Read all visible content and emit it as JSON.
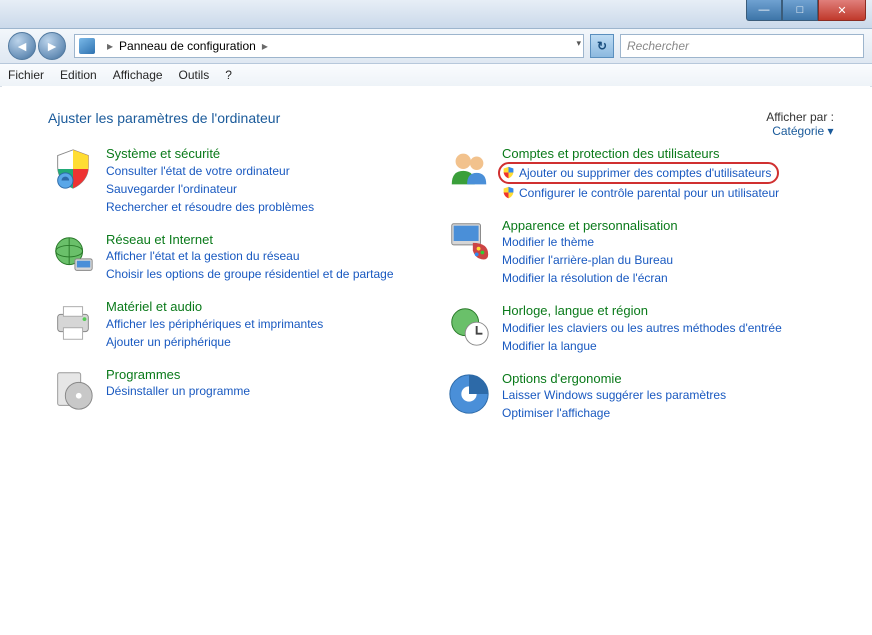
{
  "titlebar": {
    "min": "—",
    "max": "□",
    "close": "✕"
  },
  "nav": {
    "back": "◄",
    "forward": "►",
    "refresh": "↻"
  },
  "address": {
    "location": "Panneau de configuration",
    "sep": "▸",
    "dropdown": "▾"
  },
  "search": {
    "placeholder": "Rechercher"
  },
  "menu": {
    "file": "Fichier",
    "edit": "Edition",
    "view": "Affichage",
    "tools": "Outils",
    "help": "?"
  },
  "page": {
    "heading": "Ajuster les paramètres de l'ordinateur",
    "viewby_label": "Afficher par :",
    "viewby_value": "Catégorie ▾"
  },
  "left": [
    {
      "title": "Système et sécurité",
      "links": [
        "Consulter l'état de votre ordinateur",
        "Sauvegarder l'ordinateur",
        "Rechercher et résoudre des problèmes"
      ]
    },
    {
      "title": "Réseau et Internet",
      "links": [
        "Afficher l'état et la gestion du réseau",
        "Choisir les options de groupe résidentiel et de partage"
      ]
    },
    {
      "title": "Matériel et audio",
      "links": [
        "Afficher les périphériques et imprimantes",
        "Ajouter un périphérique"
      ]
    },
    {
      "title": "Programmes",
      "links": [
        "Désinstaller un programme"
      ]
    }
  ],
  "right": [
    {
      "title": "Comptes et protection des utilisateurs",
      "links": [
        "Ajouter ou supprimer des comptes d'utilisateurs",
        "Configurer le contrôle parental pour un utilisateur"
      ],
      "shield": [
        true,
        true
      ],
      "highlight": 0
    },
    {
      "title": "Apparence et personnalisation",
      "links": [
        "Modifier le thème",
        "Modifier l'arrière-plan du Bureau",
        "Modifier la résolution de l'écran"
      ]
    },
    {
      "title": "Horloge, langue et région",
      "links": [
        "Modifier les claviers ou les autres méthodes d'entrée",
        "Modifier la langue"
      ]
    },
    {
      "title": "Options d'ergonomie",
      "links": [
        "Laisser Windows suggérer les paramètres",
        "Optimiser l'affichage"
      ]
    }
  ]
}
